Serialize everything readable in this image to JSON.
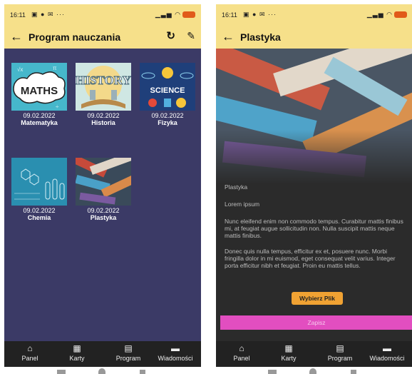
{
  "status_bar": {
    "time": "16:11",
    "notifications": "▣ ● ✉ ···",
    "signal": "▁▃▅ ◠"
  },
  "colors": {
    "appbar": "#f6e08a",
    "left_background": "#3b3a66",
    "right_background": "#2b2b2b",
    "accent_button": "#f0a233",
    "save_button": "#e24ec0",
    "navbar": "#222222"
  },
  "left_screen": {
    "title": "Program nauczania",
    "icons": {
      "back": "arrow-back-icon",
      "refresh": "refresh-icon",
      "edit": "pencil-icon"
    },
    "subjects": [
      {
        "date": "09.02.2022",
        "name": "Matematyka",
        "cover_text": "MATHS"
      },
      {
        "date": "09.02.2022",
        "name": "Historia",
        "cover_text": "HISTORY"
      },
      {
        "date": "09.02.2022",
        "name": "Fizyka",
        "cover_text": "SCIENCE"
      },
      {
        "date": "09.02.2022",
        "name": "Chemia"
      },
      {
        "date": "09.02.2022",
        "name": "Plastyka"
      }
    ]
  },
  "right_screen": {
    "title": "Plastyka",
    "subject_label": "Plastyka",
    "subtitle": "Lorem ipsum",
    "paragraph1": "Nunc eleifend enim non commodo tempus. Curabitur mattis finibus mi, at feugiat augue sollicitudin non. Nulla suscipit mattis neque mattis finibus.",
    "paragraph2": "Donec quis nulla tempus, efficitur ex et, posuere nunc. Morbi fringilla dolor in mi euismod, eget consequat velit varius. Integer porta efficitur nibh et feugiat. Proin eu mattis tellus.",
    "pick_button": "Wybierz Plik",
    "save_button": "Zapisz"
  },
  "nav": [
    {
      "label": "Panel",
      "icon": "home-icon"
    },
    {
      "label": "Karty",
      "icon": "calendar-icon"
    },
    {
      "label": "Program",
      "icon": "library-icon"
    },
    {
      "label": "Wiadomości",
      "icon": "message-icon"
    }
  ]
}
